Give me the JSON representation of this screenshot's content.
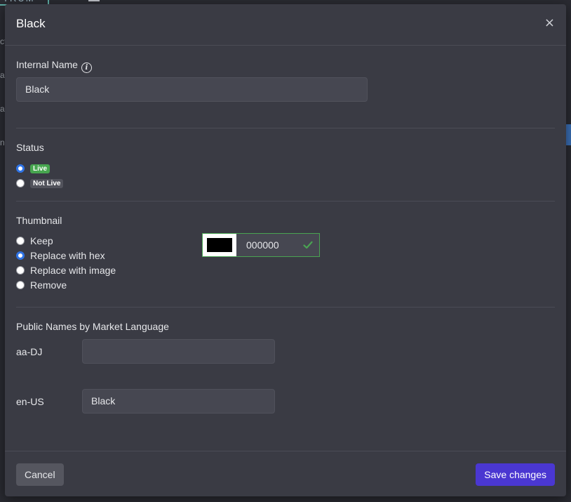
{
  "background": {
    "logo_text": "TRUM",
    "sidebar_fragments": [
      "ct",
      "a",
      "a",
      "n"
    ]
  },
  "dialog": {
    "title": "Black",
    "close_label": "×"
  },
  "internal_name": {
    "label": "Internal Name",
    "value": "Black"
  },
  "status": {
    "label": "Status",
    "options": [
      {
        "label": "Live",
        "checked": true
      },
      {
        "label": "Not Live",
        "checked": false
      }
    ]
  },
  "thumbnail": {
    "label": "Thumbnail",
    "options": [
      {
        "label": "Keep",
        "checked": false
      },
      {
        "label": "Replace with hex",
        "checked": true
      },
      {
        "label": "Replace with image",
        "checked": false
      },
      {
        "label": "Remove",
        "checked": false
      }
    ],
    "hex_value": "000000",
    "swatch_color": "#000000",
    "valid_color": "#4aa452"
  },
  "public_names": {
    "label": "Public Names by Market Language",
    "rows": [
      {
        "locale": "aa-DJ",
        "value": ""
      },
      {
        "locale": "en-US",
        "value": "Black"
      }
    ]
  },
  "footer": {
    "cancel_label": "Cancel",
    "save_label": "Save changes"
  },
  "colors": {
    "accent": "#4a37d1",
    "live_badge": "#47a64f",
    "radio_checked": "#2f74e6"
  }
}
